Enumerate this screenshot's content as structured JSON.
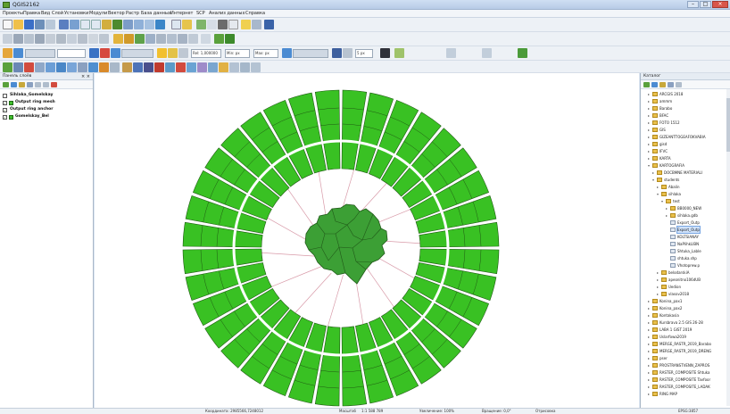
{
  "window": {
    "title": "QGIS2162",
    "controls": [
      "–",
      "□",
      "×"
    ]
  },
  "menu": [
    "Проекты",
    "Правка",
    "Вид",
    "Слой",
    "Установки",
    "Модули",
    "Вектор",
    "Растр",
    "База данных",
    "Интернет",
    "SCP",
    "Анализ данных",
    "Справка"
  ],
  "toolbars": {
    "combos": [
      {
        "value": "",
        "placeholder": ""
      },
      {
        "value": "Rel: 1,000000",
        "placeholder": ""
      },
      {
        "value": "Min: px",
        "placeholder": ""
      },
      {
        "value": "Max: px",
        "placeholder": ""
      },
      {
        "value": "5 px",
        "placeholder": ""
      }
    ]
  },
  "layers_panel": {
    "title": "Панель слоёв",
    "close": "× ×",
    "layers": [
      {
        "name": "Sihlaka_Gomelskay",
        "checked": false,
        "swatch": false
      },
      {
        "name": "Output ring mesh",
        "checked": true,
        "swatch": true
      },
      {
        "name": "Output ring anchor",
        "checked": true,
        "swatch": false
      },
      {
        "name": "Gomelskay_Bel",
        "checked": true,
        "swatch": true
      }
    ]
  },
  "browser_panel": {
    "title": "Каталог",
    "items": [
      {
        "label": "ARCGIS 2018",
        "indent": 1,
        "type": "folder"
      },
      {
        "label": "ammm",
        "indent": 1,
        "type": "folder"
      },
      {
        "label": "Barabo",
        "indent": 1,
        "type": "folder"
      },
      {
        "label": "BFAC",
        "indent": 1,
        "type": "folder"
      },
      {
        "label": "FOTO 1512",
        "indent": 1,
        "type": "folder"
      },
      {
        "label": "GIS",
        "indent": 1,
        "type": "folder"
      },
      {
        "label": "GIZEANTTOGEAFOKVABIA",
        "indent": 1,
        "type": "folder"
      },
      {
        "label": "gisd",
        "indent": 1,
        "type": "folder"
      },
      {
        "label": "IFVC",
        "indent": 1,
        "type": "folder"
      },
      {
        "label": "KARTA",
        "indent": 1,
        "type": "folder"
      },
      {
        "label": "KARTOGRAFIA",
        "indent": 1,
        "type": "folder",
        "open": true
      },
      {
        "label": "DOCBMNE MATERIALI",
        "indent": 2,
        "type": "folder"
      },
      {
        "label": "students",
        "indent": 2,
        "type": "folder",
        "open": true
      },
      {
        "label": "Abalin",
        "indent": 3,
        "type": "folder"
      },
      {
        "label": "sihlaka",
        "indent": 3,
        "type": "folder",
        "open": true
      },
      {
        "label": "test",
        "indent": 4,
        "type": "folder",
        "open": true
      },
      {
        "label": "BB0000_NEW",
        "indent": 5,
        "type": "folder"
      },
      {
        "label": "sihlaka.gdb",
        "indent": 5,
        "type": "folder"
      },
      {
        "label": "Export_Outp",
        "indent": 5,
        "type": "file"
      },
      {
        "label": "Export_Outp",
        "indent": 5,
        "type": "file",
        "selected": true
      },
      {
        "label": "KOLTSIANAY",
        "indent": 5,
        "type": "file"
      },
      {
        "label": "NaPlihkLIBN",
        "indent": 5,
        "type": "file"
      },
      {
        "label": "Shtuka_Lable",
        "indent": 5,
        "type": "file"
      },
      {
        "label": "shtuka.shp",
        "indent": 5,
        "type": "file"
      },
      {
        "label": "Vhotoprew.p",
        "indent": 5,
        "type": "file"
      },
      {
        "label": "belodarskiA",
        "indent": 3,
        "type": "folder"
      },
      {
        "label": "apeonitno106dUB",
        "indent": 3,
        "type": "folder"
      },
      {
        "label": "Uedion",
        "indent": 3,
        "type": "folder"
      },
      {
        "label": "vlasov2018",
        "indent": 3,
        "type": "folder"
      },
      {
        "label": "Konina_pax1",
        "indent": 1,
        "type": "folder"
      },
      {
        "label": "Konina_pax2",
        "indent": 1,
        "type": "folder"
      },
      {
        "label": "Kontakasia",
        "indent": 1,
        "type": "folder"
      },
      {
        "label": "Kursbrava 2.5 GIS 26-28",
        "indent": 1,
        "type": "folder"
      },
      {
        "label": "LABA 1 GIST 2019",
        "indent": 1,
        "type": "folder"
      },
      {
        "label": "Uslarfowa2019",
        "indent": 1,
        "type": "folder"
      },
      {
        "label": "MERGE_RASTR_2019_Barabo",
        "indent": 1,
        "type": "folder"
      },
      {
        "label": "MERGE_RASTR_2019_DRENG",
        "indent": 1,
        "type": "folder"
      },
      {
        "label": "pser",
        "indent": 1,
        "type": "folder"
      },
      {
        "label": "PROSTRANSTVENN_ZAPROS",
        "indent": 1,
        "type": "folder"
      },
      {
        "label": "RASTER_COMPOSITE Shtuka",
        "indent": 1,
        "type": "folder"
      },
      {
        "label": "RASTER_COMPOSITE Tavfoor",
        "indent": 1,
        "type": "folder"
      },
      {
        "label": "RASTER_COMPOSITE_LADAK",
        "indent": 1,
        "type": "folder"
      },
      {
        "label": "RING MAP",
        "indent": 1,
        "type": "folder"
      }
    ]
  },
  "map": {
    "ring_fill": "#39c123",
    "ring_stroke": "#1f5a13",
    "region_fill": "#3c9f35",
    "spoke_color": "#d89aa8"
  },
  "statusbar": {
    "coord": "Координата: 2985566,7248012",
    "scale_label": "Масштаб",
    "scale": "1:1 588 789",
    "magnifier": "Увеличение: 100%",
    "rotation": "Вращение: 0,0°",
    "render": "Отрисовка",
    "crs": "EPSG:3857"
  }
}
